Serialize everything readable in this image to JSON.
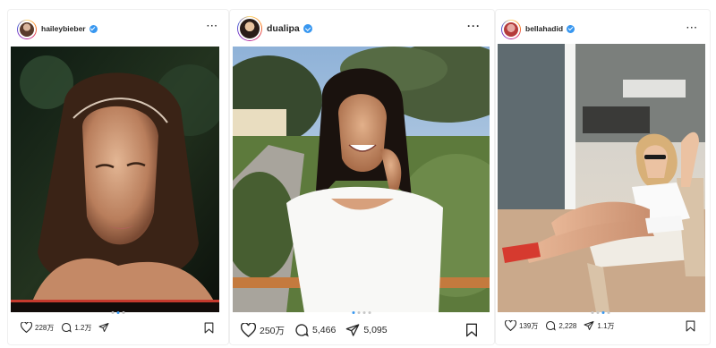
{
  "posts": [
    {
      "username": "haileybieber",
      "verified": true,
      "likes": "228万",
      "comments": "1.2万",
      "carousel_dots": 3,
      "active_dot": 1
    },
    {
      "username": "dualipa",
      "verified": true,
      "likes": "250万",
      "comments": "5,466",
      "shares": "5,095",
      "carousel_dots": 4,
      "active_dot": 0
    },
    {
      "username": "bellahadid",
      "verified": true,
      "likes": "139万",
      "comments": "2,228",
      "shares": "1.1万",
      "carousel_dots": 4,
      "active_dot": 2
    }
  ],
  "icons": {
    "like": "heart-icon",
    "comment": "comment-icon",
    "share": "paper-plane-icon",
    "save": "bookmark-icon",
    "menu": "more-icon"
  },
  "colors": {
    "verified": "#3897f0",
    "active_dot": "#3897f0",
    "text": "#262626"
  }
}
